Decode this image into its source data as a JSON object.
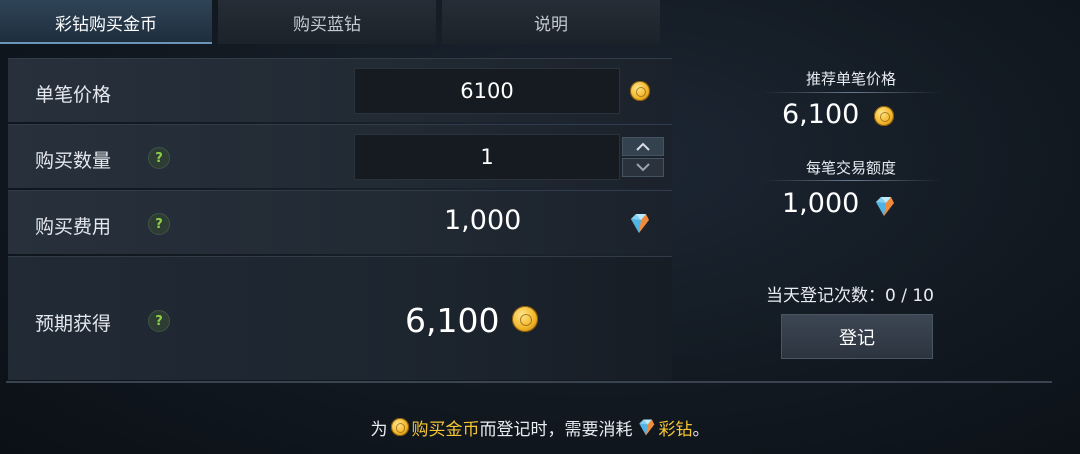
{
  "tabs": [
    {
      "label": "彩钻购买金币",
      "active": true
    },
    {
      "label": "购买蓝钻",
      "active": false
    },
    {
      "label": "说明",
      "active": false
    }
  ],
  "form": {
    "unit_price": {
      "label": "单笔价格",
      "value": "6100",
      "icon": "gold-coin-icon"
    },
    "quantity": {
      "label": "购买数量",
      "help": "?",
      "value": "1"
    },
    "cost": {
      "label": "购买费用",
      "help": "?",
      "value": "1,000",
      "icon": "colored-diamond-icon"
    },
    "expected": {
      "label": "预期获得",
      "help": "?",
      "value": "6,100",
      "icon": "gold-coin-icon"
    }
  },
  "side": {
    "recommended_label": "推荐单笔价格",
    "recommended_value": "6,100",
    "limit_label": "每笔交易额度",
    "limit_value": "1,000",
    "register_count": "当天登记次数：0 / 10",
    "register_button": "登记"
  },
  "note": {
    "prefix": "为",
    "highlight1": "购买金币",
    "middle": "而登记时，需要消耗",
    "highlight2": "彩钻",
    "suffix": "。"
  },
  "colors": {
    "accent_gold": "#f4c534",
    "help_green": "#8fd14b",
    "active_tab": "#2f4458"
  }
}
